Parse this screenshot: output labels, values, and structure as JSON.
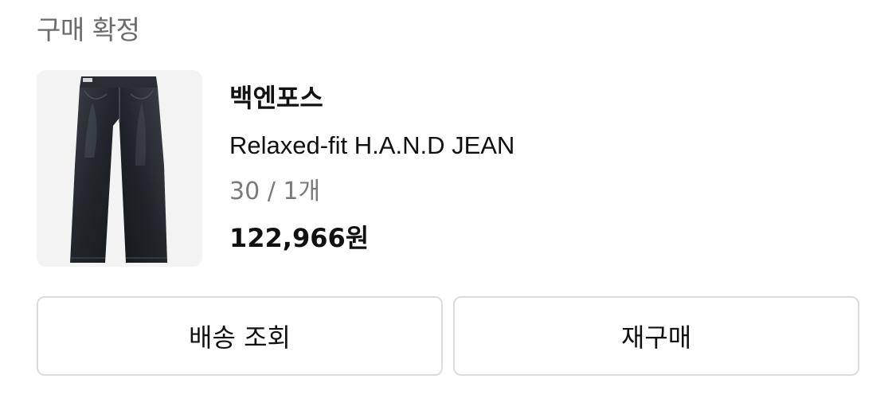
{
  "order": {
    "status_label": "구매 확정"
  },
  "product": {
    "brand": "백엔포스",
    "name": "Relaxed-fit H.A.N.D JEAN",
    "option": "30 / 1개",
    "price": "122,966원",
    "image_icon": "jeans-product-image"
  },
  "actions": {
    "track_label": "배송 조회",
    "rebuy_label": "재구매"
  }
}
